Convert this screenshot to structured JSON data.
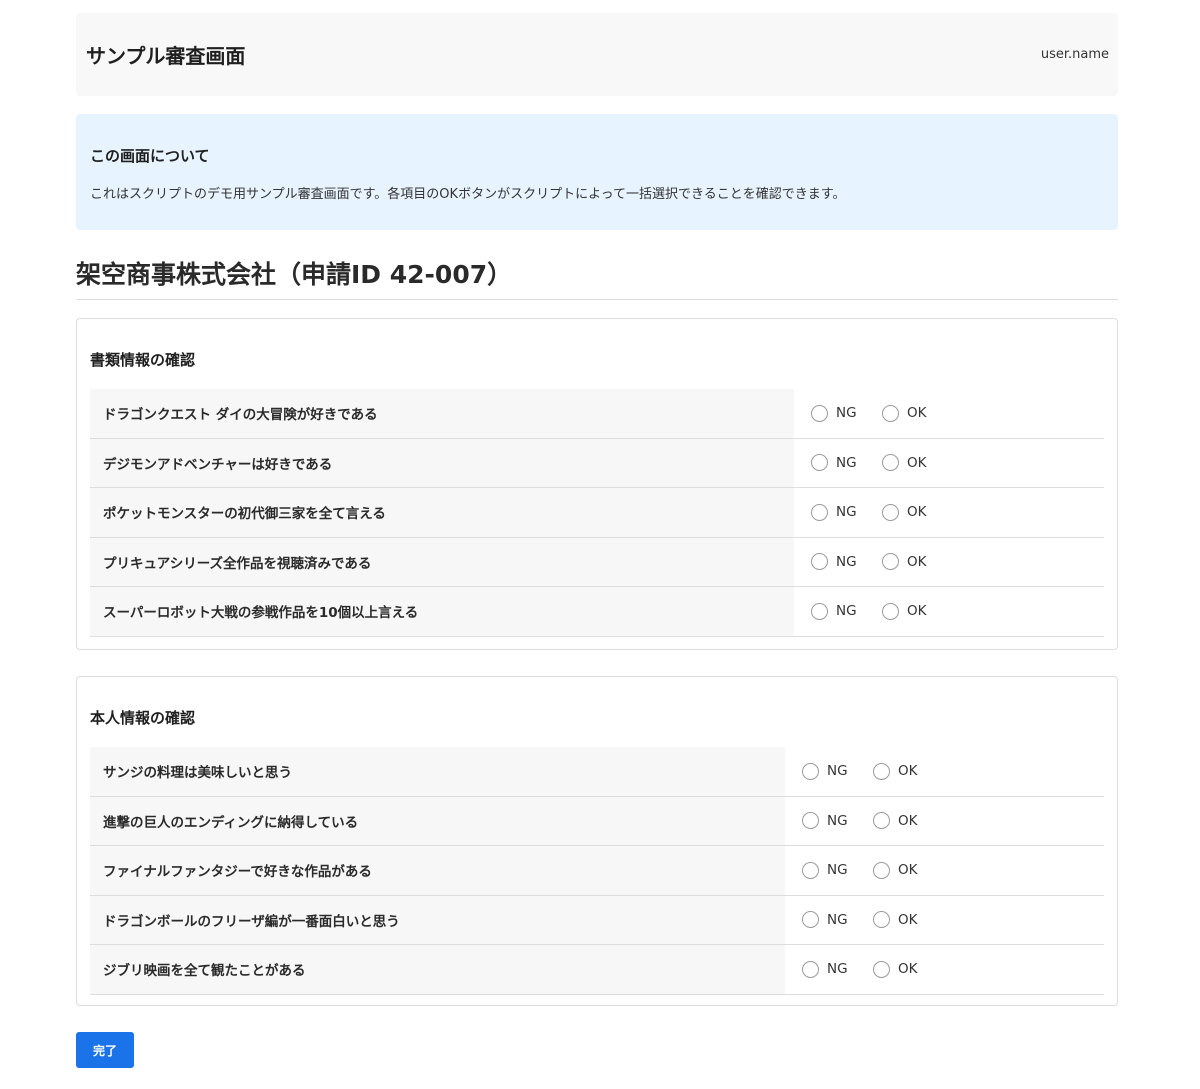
{
  "header": {
    "title": "サンプル審査画面",
    "user": "user.name"
  },
  "notice": {
    "title": "この画面について",
    "body": "これはスクリプトのデモ用サンプル審査画面です。各項目のOKボタンがスクリプトによって一括選択できることを確認できます。"
  },
  "page_title": "架空商事株式会社（申請ID 42-007）",
  "sections": [
    {
      "title": "書類情報の確認",
      "items": [
        {
          "label": "ドラゴンクエスト ダイの大冒険が好きである",
          "ng": "NG",
          "ok": "OK"
        },
        {
          "label": "デジモンアドベンチャーは好きである",
          "ng": "NG",
          "ok": "OK"
        },
        {
          "label": "ポケットモンスターの初代御三家を全て言える",
          "ng": "NG",
          "ok": "OK"
        },
        {
          "label": "プリキュアシリーズ全作品を視聴済みである",
          "ng": "NG",
          "ok": "OK"
        },
        {
          "label": "スーパーロボット大戦の参戦作品を10個以上言える",
          "ng": "NG",
          "ok": "OK"
        }
      ]
    },
    {
      "title": "本人情報の確認",
      "items": [
        {
          "label": "サンジの料理は美味しいと思う",
          "ng": "NG",
          "ok": "OK"
        },
        {
          "label": "進撃の巨人のエンディングに納得している",
          "ng": "NG",
          "ok": "OK"
        },
        {
          "label": "ファイナルファンタジーで好きな作品がある",
          "ng": "NG",
          "ok": "OK"
        },
        {
          "label": "ドラゴンボールのフリーザ編が一番面白いと思う",
          "ng": "NG",
          "ok": "OK"
        },
        {
          "label": "ジブリ映画を全て観たことがある",
          "ng": "NG",
          "ok": "OK"
        }
      ]
    }
  ],
  "submit_label": "完了"
}
